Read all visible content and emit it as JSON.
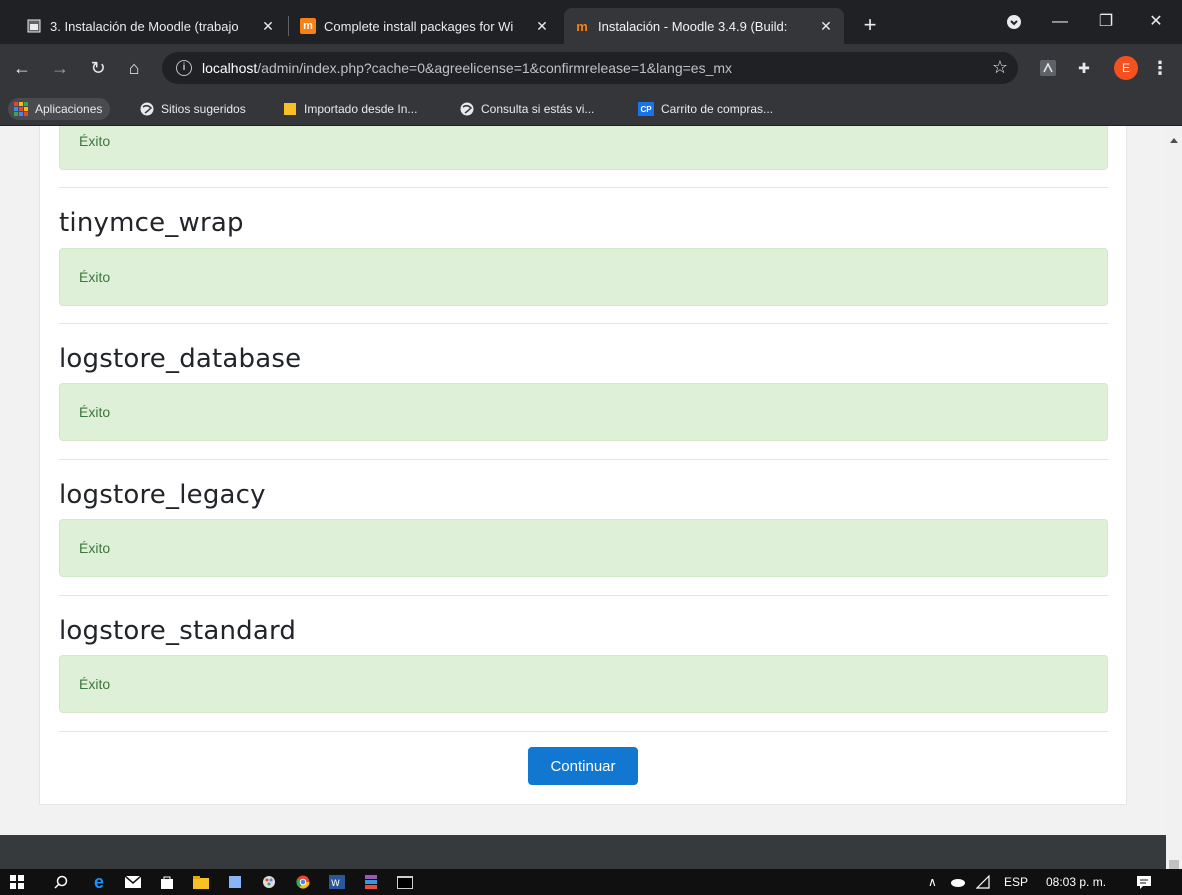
{
  "browser": {
    "tabs": [
      {
        "title": "3. Instalación de Moodle (trabajo",
        "favicon": "doc-icon",
        "active": false
      },
      {
        "title": "Complete install packages for Wi",
        "favicon": "moodle-icon",
        "active": false
      },
      {
        "title": "Instalación - Moodle 3.4.9 (Build:",
        "favicon": "moodle-icon",
        "active": true
      }
    ],
    "url_host": "localhost",
    "url_path": "/admin/index.php?cache=0&agreelicense=1&confirmrelease=1&lang=es_mx",
    "avatar_initial": "E",
    "bookmarks": [
      {
        "label": "Aplicaciones",
        "icon": "apps-grid-icon"
      },
      {
        "label": "Sitios sugeridos",
        "icon": "globe-icon"
      },
      {
        "label": "Importado desde In...",
        "icon": "folder-icon"
      },
      {
        "label": "Consulta si estás vi...",
        "icon": "globe-icon"
      },
      {
        "label": "Carrito de compras...",
        "icon": "cp-icon",
        "icon_text": "CP"
      }
    ]
  },
  "page": {
    "top_alert": "Éxito",
    "sections": [
      {
        "heading": "tinymce_wrap",
        "status": "Éxito"
      },
      {
        "heading": "logstore_database",
        "status": "Éxito"
      },
      {
        "heading": "logstore_legacy",
        "status": "Éxito"
      },
      {
        "heading": "logstore_standard",
        "status": "Éxito"
      }
    ],
    "continue_label": "Continuar"
  },
  "taskbar": {
    "language": "ESP",
    "time": "08:03 p. m."
  },
  "colors": {
    "success_bg": "#dff0d8",
    "success_text": "#3c763d",
    "primary_button": "#1177d1",
    "footer": "#373a3c"
  }
}
